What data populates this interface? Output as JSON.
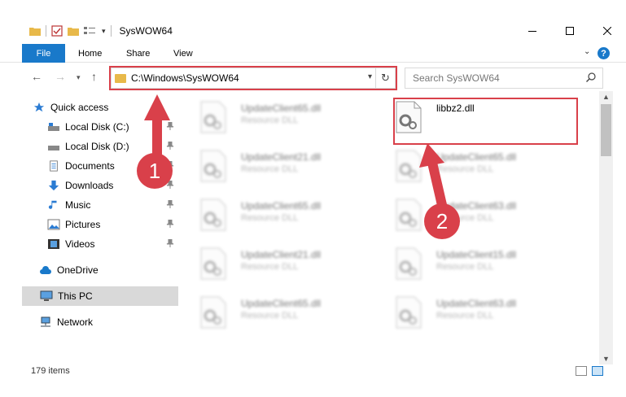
{
  "window": {
    "title": "SysWOW64"
  },
  "ribbon": {
    "file": "File",
    "home": "Home",
    "share": "Share",
    "view": "View"
  },
  "address": {
    "path": "C:\\Windows\\SysWOW64"
  },
  "search": {
    "placeholder": "Search SysWOW64"
  },
  "sidebar": {
    "quick_access": "Quick access",
    "local_c": "Local Disk (C:)",
    "local_d": "Local Disk (D:)",
    "documents": "Documents",
    "downloads": "Downloads",
    "music": "Music",
    "pictures": "Pictures",
    "videos": "Videos",
    "onedrive": "OneDrive",
    "this_pc": "This PC",
    "network": "Network"
  },
  "files": [
    {
      "name": "UpdateClient65.dll",
      "desc": "Resource DLL"
    },
    {
      "name": "libbz2.dll",
      "desc": ""
    },
    {
      "name": "UpdateClient21.dll",
      "desc": "Resource DLL"
    },
    {
      "name": "UpdateClient65.dll",
      "desc": "Resource DLL"
    },
    {
      "name": "UpdateClient65.dll",
      "desc": "Resource DLL"
    },
    {
      "name": "UpdateClient63.dll",
      "desc": "Resource DLL"
    },
    {
      "name": "UpdateClient21.dll",
      "desc": "Resource DLL"
    },
    {
      "name": "UpdateClient15.dll",
      "desc": "Resource DLL"
    },
    {
      "name": "UpdateClient65.dll",
      "desc": "Resource DLL"
    },
    {
      "name": "UpdateClient63.dll",
      "desc": "Resource DLL"
    }
  ],
  "status": {
    "count": "179 items"
  },
  "annotations": {
    "one": "1",
    "two": "2"
  },
  "colors": {
    "accent": "#1979ca",
    "annotation": "#d9404a",
    "folder": "#e8b94a"
  },
  "icons": {
    "folder": "folder-icon",
    "properties": "properties-icon",
    "new_folder": "new-folder-icon",
    "back": "back-arrow-icon",
    "forward": "forward-arrow-icon",
    "up": "up-arrow-icon",
    "refresh": "refresh-icon",
    "search": "search-icon",
    "help": "help-icon",
    "dll": "dll-gear-icon"
  }
}
